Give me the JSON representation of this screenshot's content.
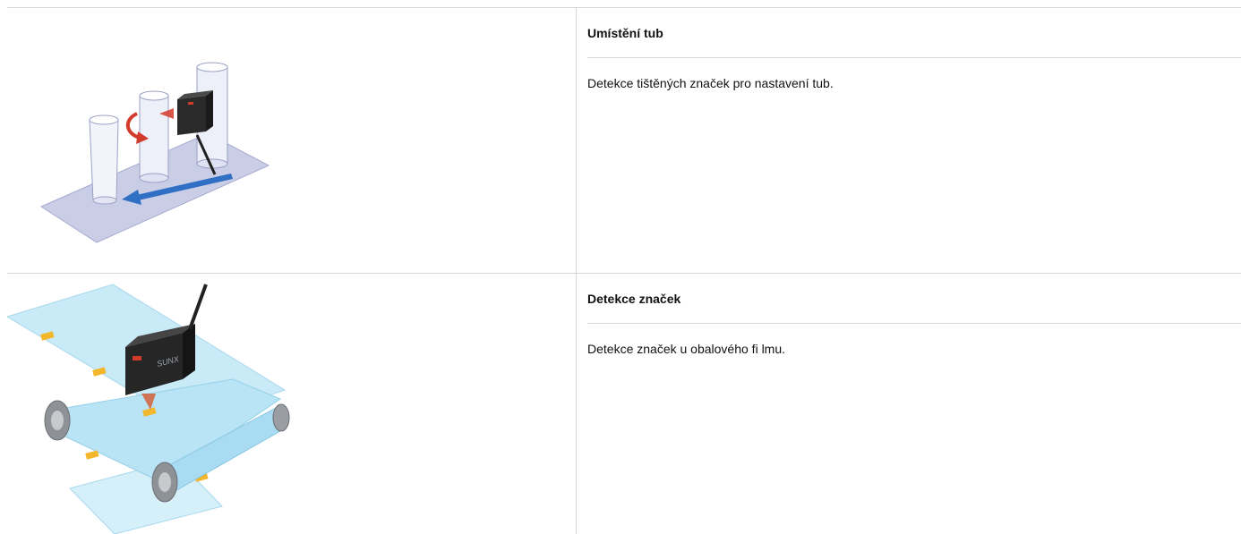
{
  "rows": [
    {
      "title": "Umístění tub",
      "description": "Detekce tištěných značek pro nastavení tub.",
      "illustration": "tube-positioning-sensor-illustration"
    },
    {
      "title": "Detekce značek",
      "description": "Detekce značek u obalového fi lmu.",
      "illustration": "mark-detection-film-illustration"
    }
  ],
  "sensor_logo": "SUNX",
  "colors": {
    "border": "#d6d6d6",
    "arrow_blue": "#2f6fc4",
    "arrow_red": "#d23a2a",
    "mark_yellow": "#f2b72b",
    "film_blue": "#bfe6f6",
    "sensor_body": "#2a2a2a"
  }
}
